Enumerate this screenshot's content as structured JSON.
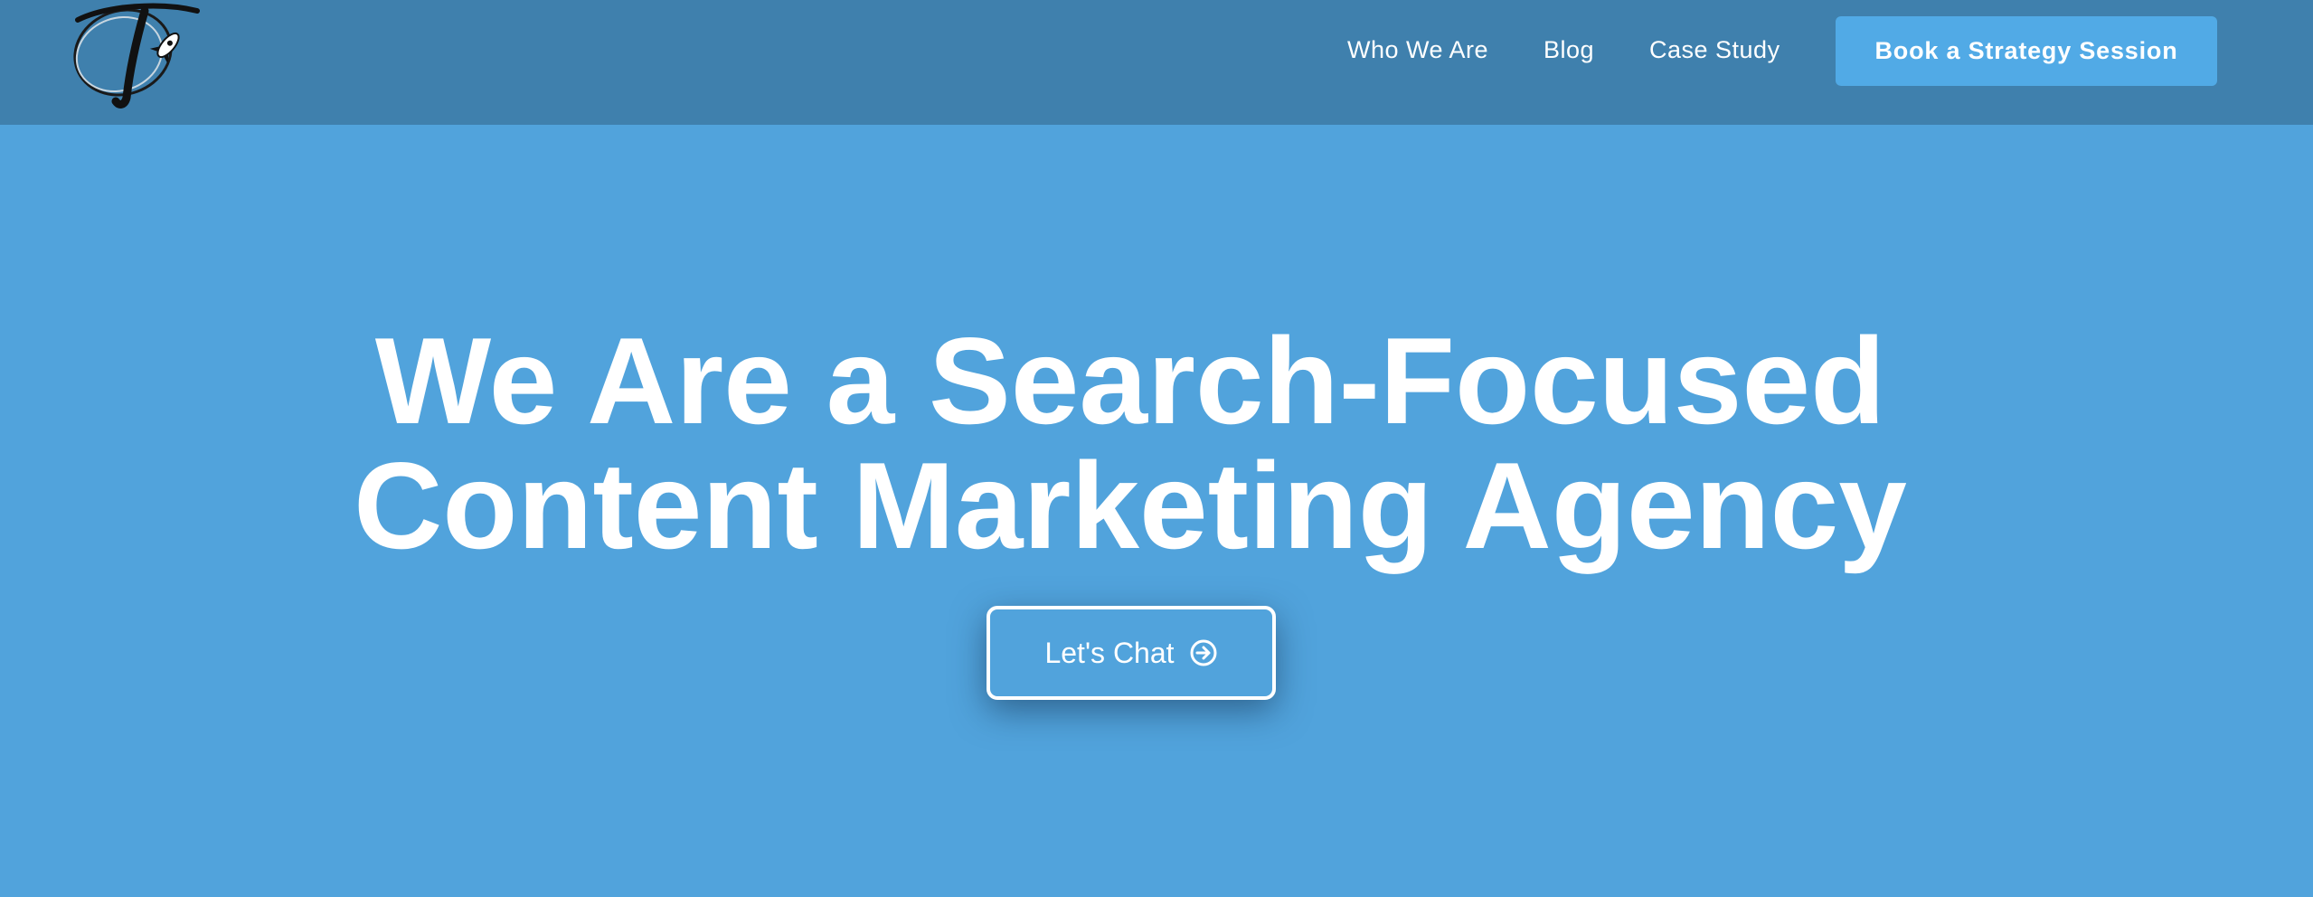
{
  "brand": {
    "logo_icon": "rocket-script-t-logo",
    "logo_letter": "T"
  },
  "nav": {
    "items": [
      {
        "label": "Who We Are"
      },
      {
        "label": "Blog"
      },
      {
        "label": "Case Study"
      }
    ],
    "cta_label": "Book a Strategy Session"
  },
  "hero": {
    "title_line1": "We Are a Search-Focused",
    "title_line2": "Content Marketing Agency",
    "button_label": "Let's Chat",
    "button_icon": "arrow-circle-right-icon"
  },
  "colors": {
    "header_bg": "#3f80ad",
    "page_bg": "#51a3dc",
    "cta_bg": "#51aae6",
    "text": "#ffffff"
  }
}
